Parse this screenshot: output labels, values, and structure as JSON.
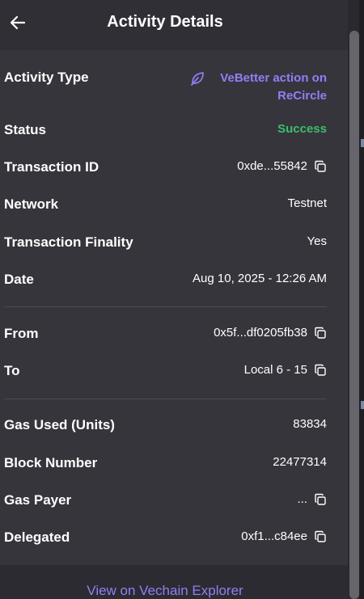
{
  "header": {
    "title": "Activity Details",
    "back_icon": "arrow-left-icon"
  },
  "rows": {
    "activity_type": {
      "label": "Activity Type",
      "value": "VeBetter action on ReCircle",
      "icon": "leaf-icon"
    },
    "status": {
      "label": "Status",
      "value": "Success",
      "color": "#3dbd6b"
    },
    "transaction_id": {
      "label": "Transaction ID",
      "value": "0xde...55842"
    },
    "network": {
      "label": "Network",
      "value": "Testnet"
    },
    "finality": {
      "label": "Transaction Finality",
      "value": "Yes"
    },
    "date": {
      "label": "Date",
      "value": "Aug 10, 2025 - 12:26 AM"
    },
    "from": {
      "label": "From",
      "value": "0x5f...df0205fb38"
    },
    "to": {
      "label": "To",
      "value": "Local 6 - 15"
    },
    "gas_used": {
      "label": "Gas Used (Units)",
      "value": "83834"
    },
    "block_number": {
      "label": "Block Number",
      "value": "22477314"
    },
    "gas_payer": {
      "label": "Gas Payer",
      "value": "..."
    },
    "delegated": {
      "label": "Delegated",
      "value": "0xf1...c84ee"
    }
  },
  "footer": {
    "link_label": "View on Vechain Explorer"
  },
  "colors": {
    "accent": "#8f7ff6",
    "success": "#3dbd6b",
    "panel": "#36353c"
  }
}
